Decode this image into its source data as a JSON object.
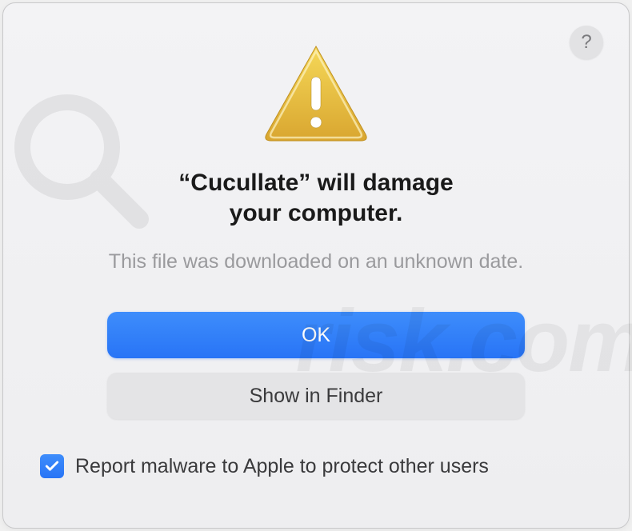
{
  "dialog": {
    "title_line1": "“Cucullate” will damage",
    "title_line2": "your computer.",
    "subtitle": "This file was downloaded on an unknown date.",
    "help_label": "?",
    "buttons": {
      "ok_label": "OK",
      "show_in_finder_label": "Show in Finder"
    },
    "checkbox": {
      "checked": true,
      "label": "Report malware to Apple to protect other users"
    }
  },
  "watermark": {
    "text": "risk.com"
  }
}
